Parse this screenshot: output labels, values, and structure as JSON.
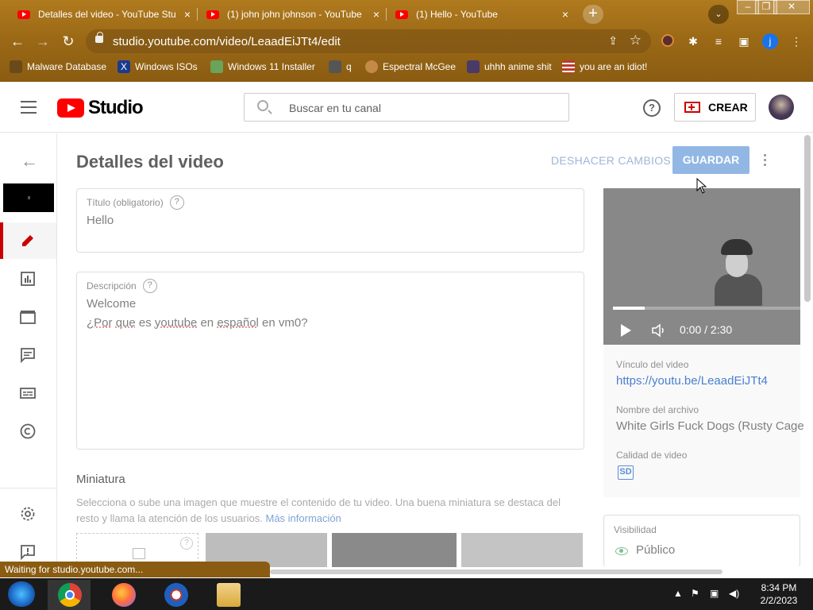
{
  "browser": {
    "tabs": [
      {
        "title": "Detalles del video - YouTube Stu",
        "close": "×"
      },
      {
        "title": "(1) john john johnson - YouTube",
        "close": "×"
      },
      {
        "title": "(1) Hello - YouTube",
        "close": "×"
      }
    ],
    "new_tab_label": "+",
    "tab_search_label": "⌄",
    "window_controls": {
      "minimize": "–",
      "maximize": "❐",
      "close": "✕"
    },
    "nav": {
      "back": "←",
      "forward": "→",
      "reload": "↻"
    },
    "url": "studio.youtube.com/video/LeaadEiJTt4/edit",
    "profile_initial": "j",
    "bookmarks": [
      {
        "label": "Malware Database",
        "icon": "bookmark-malware-icon",
        "color": "#6b4a1a"
      },
      {
        "label": "Windows ISOs",
        "icon": "bookmark-x-icon",
        "color": "#1b3a8f"
      },
      {
        "label": "Windows 11 Installer",
        "icon": "bookmark-image-icon",
        "color": "#6aa35a"
      },
      {
        "label": "q",
        "icon": "bookmark-q-icon",
        "color": "#555555"
      },
      {
        "label": "Espectral McGee",
        "icon": "bookmark-face-icon",
        "color": "#c58a4a"
      },
      {
        "label": "uhhh anime shit",
        "icon": "bookmark-anime-icon",
        "color": "#4a3a6a"
      },
      {
        "label": "you are an idiot!",
        "icon": "bookmark-flag-icon",
        "color": "#c0392b"
      }
    ]
  },
  "studio": {
    "search_placeholder": "Buscar en tu canal",
    "crear_label": "CREAR",
    "help_label": "?",
    "page_title": "Detalles del video",
    "deshacer_label": "DESHACER CAMBIOS",
    "guardar_label": "GUARDAR",
    "title_field": {
      "label": "Título (obligatorio)",
      "value": "Hello"
    },
    "description_field": {
      "label": "Descripción",
      "line1": "Welcome",
      "line2_words": [
        "¿Por",
        "que",
        "es",
        "youtube",
        "en",
        "español",
        "en",
        "vm0?"
      ]
    },
    "thumbnail": {
      "heading": "Miniatura",
      "description": "Selecciona o sube una imagen que muestre el contenido de tu video. Una buena miniatura se destaca del resto y llama la atención de los usuarios.",
      "link": "Más información"
    },
    "player": {
      "timecode": "0:00 / 2:30",
      "progress": 0.17
    },
    "video_info": {
      "link_label": "Vínculo del video",
      "link_value": "https://youtu.be/LeaadEiJTt4",
      "filename_label": "Nombre del archivo",
      "filename_value": "White Girls Fuck Dogs (Rusty Cage",
      "quality_label": "Calidad de video",
      "quality_badge": "SD"
    },
    "visibility": {
      "label": "Visibilidad",
      "value": "Público"
    }
  },
  "status_bar": "Waiting for studio.youtube.com...",
  "taskbar": {
    "time": "8:34 PM",
    "date": "2/2/2023"
  }
}
